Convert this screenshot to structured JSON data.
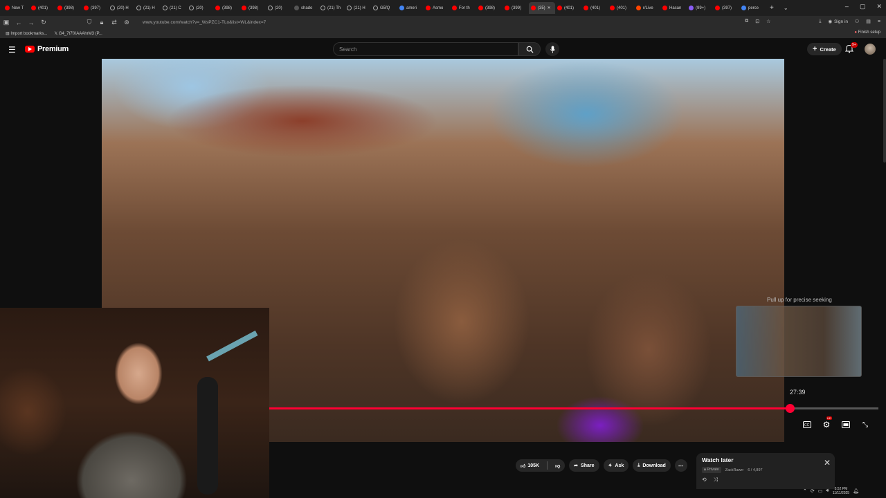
{
  "browser": {
    "tabs": [
      {
        "label": "New T",
        "icon": "yt",
        "active": false
      },
      {
        "label": "(401)",
        "icon": "yt",
        "active": false
      },
      {
        "label": "(398)",
        "icon": "yt",
        "active": false
      },
      {
        "label": "(397)",
        "icon": "yt",
        "active": false
      },
      {
        "label": "(20) H",
        "icon": "x",
        "active": false
      },
      {
        "label": "(21) H",
        "icon": "x",
        "active": false
      },
      {
        "label": "(21) C",
        "icon": "x",
        "active": false
      },
      {
        "label": "(20)",
        "icon": "x",
        "active": false
      },
      {
        "label": "(398)",
        "icon": "yt",
        "active": false
      },
      {
        "label": "(398)",
        "icon": "yt",
        "active": false
      },
      {
        "label": "(20)",
        "icon": "x",
        "active": false
      },
      {
        "label": "shado",
        "icon": "k",
        "active": false
      },
      {
        "label": "(21) Th",
        "icon": "x",
        "active": false
      },
      {
        "label": "(21) H",
        "icon": "x",
        "active": false
      },
      {
        "label": "G5fQ",
        "icon": "x",
        "active": false
      },
      {
        "label": "ameri",
        "icon": "g",
        "active": false
      },
      {
        "label": "Asmo",
        "icon": "yt",
        "active": false
      },
      {
        "label": "For th",
        "icon": "yt",
        "active": false
      },
      {
        "label": "(398)",
        "icon": "yt",
        "active": false
      },
      {
        "label": "(399)",
        "icon": "yt",
        "active": false
      },
      {
        "label": "(35)",
        "icon": "yt",
        "active": true
      },
      {
        "label": "(401)",
        "icon": "yt",
        "active": false
      },
      {
        "label": "(401)",
        "icon": "yt",
        "active": false
      },
      {
        "label": "(401)",
        "icon": "yt",
        "active": false
      },
      {
        "label": "r/Live",
        "icon": "r",
        "active": false
      },
      {
        "label": "Hasan",
        "icon": "yt",
        "active": false
      },
      {
        "label": "(99+)",
        "icon": "o",
        "active": false
      },
      {
        "label": "(397)",
        "icon": "yt",
        "active": false
      },
      {
        "label": "perce",
        "icon": "g",
        "active": false
      }
    ],
    "new_tab": "+",
    "url": "www.youtube.com/watch?v=_WsPZC1-TLo&list=WL&index=7",
    "sign_in": "Sign in",
    "bookmarks": [
      "Import bookmarks...",
      "G4_7t7fXAAAhrM3 (P..."
    ],
    "finish_setup": "Finish setup"
  },
  "youtube": {
    "brand": "Premium",
    "search_placeholder": "Search",
    "create_label": "Create",
    "notif_count": "9+"
  },
  "player": {
    "seek_hint": "Pull up for precise seeking",
    "preview_time": "27:39",
    "progress_fraction": 0.854
  },
  "actions": {
    "like_count": "105K",
    "share": "Share",
    "ask": "Ask",
    "download": "Download"
  },
  "watch_later": {
    "title": "Watch later",
    "privacy": "Private",
    "owner": "ZackRawrr",
    "position": "6 / 4,897"
  },
  "taskbar": {
    "time": "5:52 PM",
    "date": "11/11/2025"
  },
  "colors": {
    "accent": "#ff0033",
    "youtube_red": "#ff0000",
    "background": "#0f0f0f"
  }
}
